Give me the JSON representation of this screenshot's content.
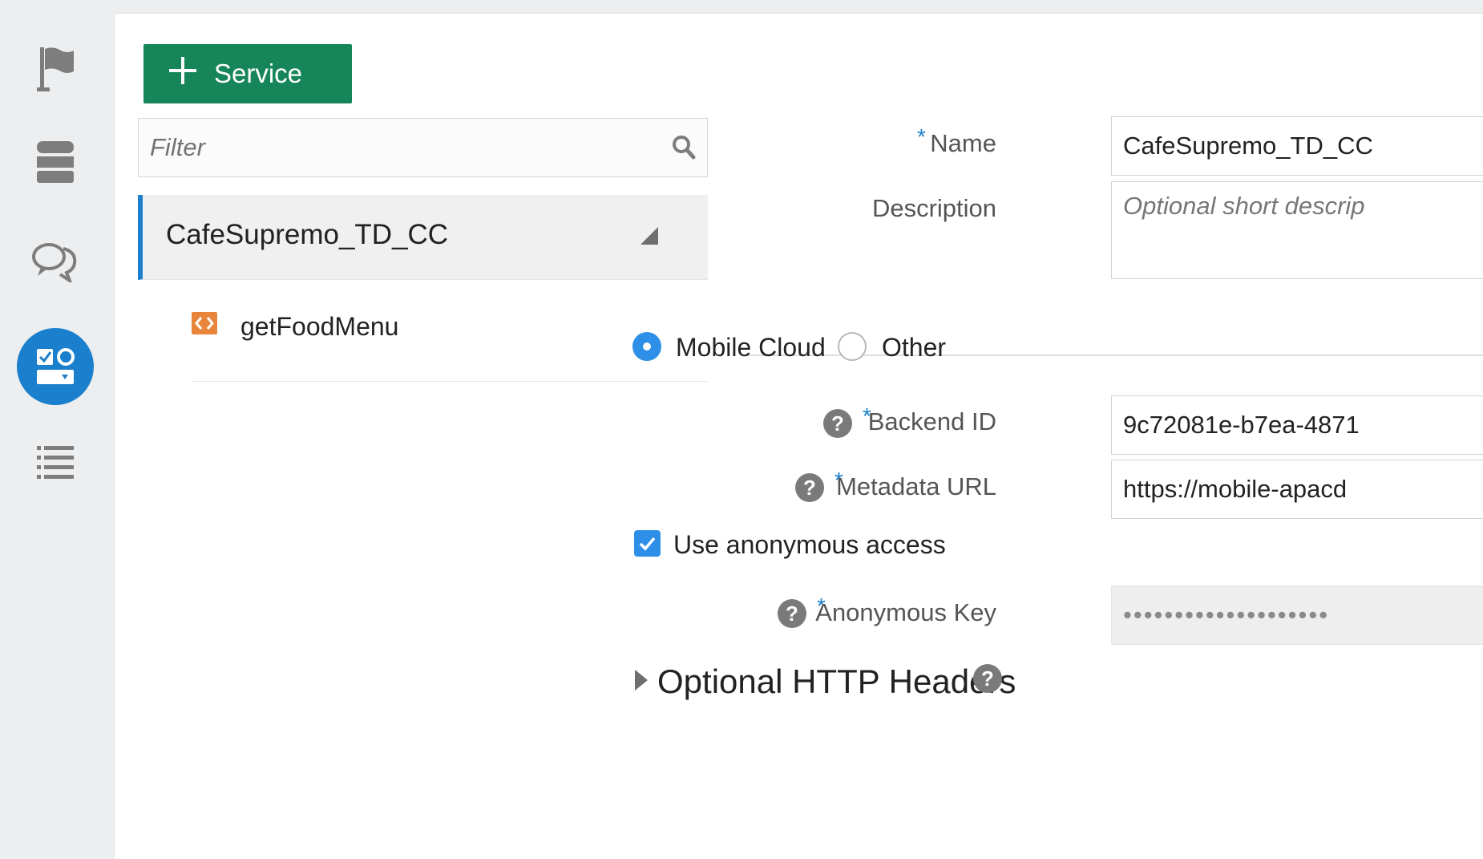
{
  "rail": {
    "items": [
      {
        "name": "flag-icon"
      },
      {
        "name": "database-icon"
      },
      {
        "name": "chat-icon"
      },
      {
        "name": "forms-icon",
        "active": true
      },
      {
        "name": "list-icon"
      }
    ],
    "active_color": "#1a7fcc"
  },
  "toolbar": {
    "add_service_label": "Service"
  },
  "filter": {
    "placeholder": "Filter"
  },
  "tree": {
    "service_name": "CafeSupremo_TD_CC",
    "children": [
      {
        "label": "getFoodMenu"
      }
    ]
  },
  "form": {
    "name": {
      "label": "Name",
      "value": "CafeSupremo_TD_CC"
    },
    "description": {
      "label": "Description",
      "placeholder": "Optional short descrip"
    },
    "source": {
      "options": [
        {
          "label": "Mobile Cloud",
          "selected": true
        },
        {
          "label": "Other",
          "selected": false
        }
      ]
    },
    "backend_id": {
      "label": "Backend ID",
      "value": "9c72081e-b7ea-4871"
    },
    "metadata_url": {
      "label": "Metadata URL",
      "value": "https://mobile-apacd"
    },
    "anonymous_access": {
      "label": "Use anonymous access",
      "checked": true
    },
    "anonymous_key": {
      "label": "Anonymous Key",
      "value": "••••••••••••••••••••"
    },
    "optional_headers": {
      "label": "Optional HTTP Headers"
    },
    "required_marker": "*",
    "help_glyph": "?"
  },
  "colors": {
    "primary_button": "#17855a",
    "accent": "#1a7fcc",
    "radio_checkbox": "#2d8fe8"
  }
}
